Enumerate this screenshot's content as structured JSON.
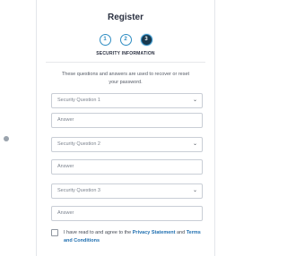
{
  "title": "Register",
  "steps": [
    {
      "label": "1",
      "state": "complete"
    },
    {
      "label": "2",
      "state": "complete"
    },
    {
      "label": "3",
      "state": "active"
    }
  ],
  "section_title": "SECURITY INFORMATION",
  "description": "These questions and answers are used to recover or reset your password.",
  "questions": [
    {
      "select_label": "Security Question 1",
      "answer_placeholder": "Answer"
    },
    {
      "select_label": "Security Question 2",
      "answer_placeholder": "Answer"
    },
    {
      "select_label": "Security Question 3",
      "answer_placeholder": "Answer"
    }
  ],
  "consent": {
    "prefix": "I have read to and agree to the",
    "privacy_link": "Privacy Statement",
    "conjunction": "and",
    "terms_link": "Terms and Conditions"
  },
  "colors": {
    "accent": "#2f8dc3",
    "active_step": "#18394f",
    "link": "#1f6fb0"
  }
}
